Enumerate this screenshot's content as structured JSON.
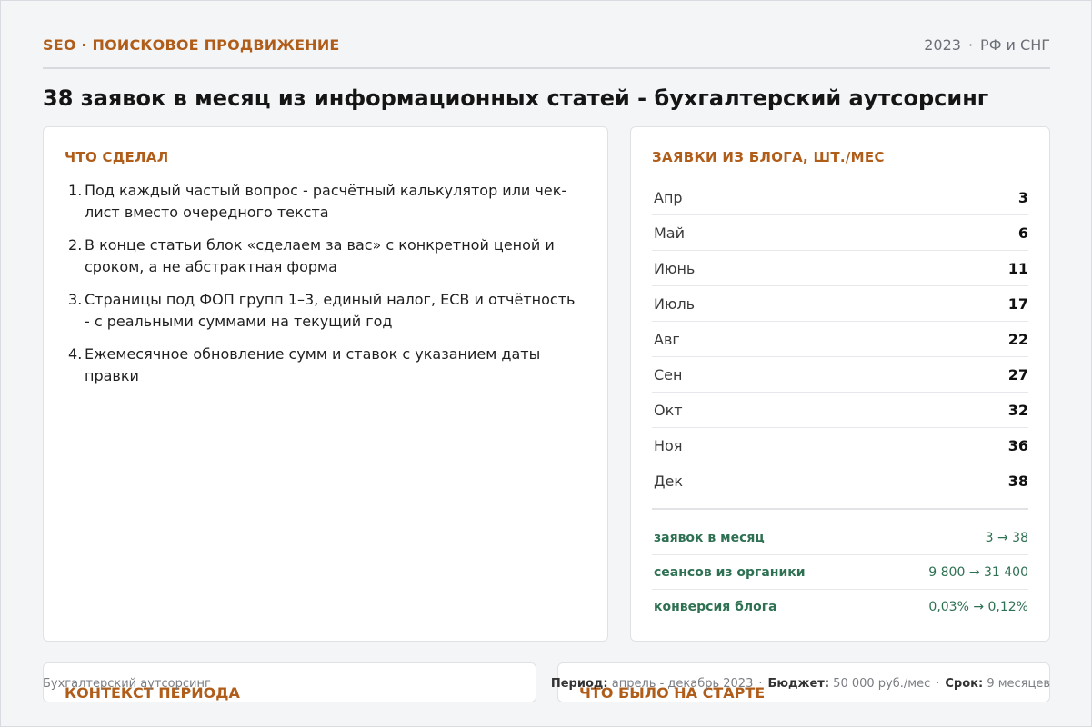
{
  "header": {
    "eyebrow": "SEO · ПОИСКОВОЕ ПРОДВИЖЕНИЕ",
    "year": "2023",
    "region": "РФ и СНГ"
  },
  "title": "38 заявок в месяц из информационных статей - бухгалтерский аутсорсинг",
  "done": {
    "label": "ЧТО СДЕЛАЛ",
    "items": [
      "Под каждый частый вопрос - расчётный калькулятор или чек-лист вместо очередного текста",
      "В конце статьи блок «сделаем за вас» с конкретной ценой и сроком, а не абстрактная форма",
      "Страницы под ФОП групп 1–3, единый налог, ЕСВ и отчётность - с реальными суммами на текущий год",
      "Ежемесячное обновление сумм и ставок с указанием даты правки"
    ]
  },
  "leads": {
    "label": "ЗАЯВКИ ИЗ БЛОГА, ШТ./МЕС",
    "months": [
      {
        "name": "Апр",
        "value": "3"
      },
      {
        "name": "Май",
        "value": "6"
      },
      {
        "name": "Июнь",
        "value": "11"
      },
      {
        "name": "Июль",
        "value": "17"
      },
      {
        "name": "Авг",
        "value": "22"
      },
      {
        "name": "Сен",
        "value": "27"
      },
      {
        "name": "Окт",
        "value": "32"
      },
      {
        "name": "Ноя",
        "value": "36"
      },
      {
        "name": "Дек",
        "value": "38"
      }
    ],
    "metrics": [
      {
        "name": "заявок в месяц",
        "value": "3 → 38"
      },
      {
        "name": "сеансов из органики",
        "value": "9 800 → 31 400"
      },
      {
        "name": "конверсия блога",
        "value": "0,03% → 0,12%"
      }
    ]
  },
  "context": {
    "label": "КОНТЕКСТ ПЕРИОДА"
  },
  "start": {
    "label": "ЧТО БЫЛО НА СТАРТЕ"
  },
  "footer": {
    "niche": "Бухгалтерский аутсорсинг",
    "period_label": "Период:",
    "period_value": "апрель - декабрь 2023",
    "budget_label": "Бюджет:",
    "budget_value": "50 000 руб./мес",
    "term_label": "Срок:",
    "term_value": "9 месяцев"
  }
}
